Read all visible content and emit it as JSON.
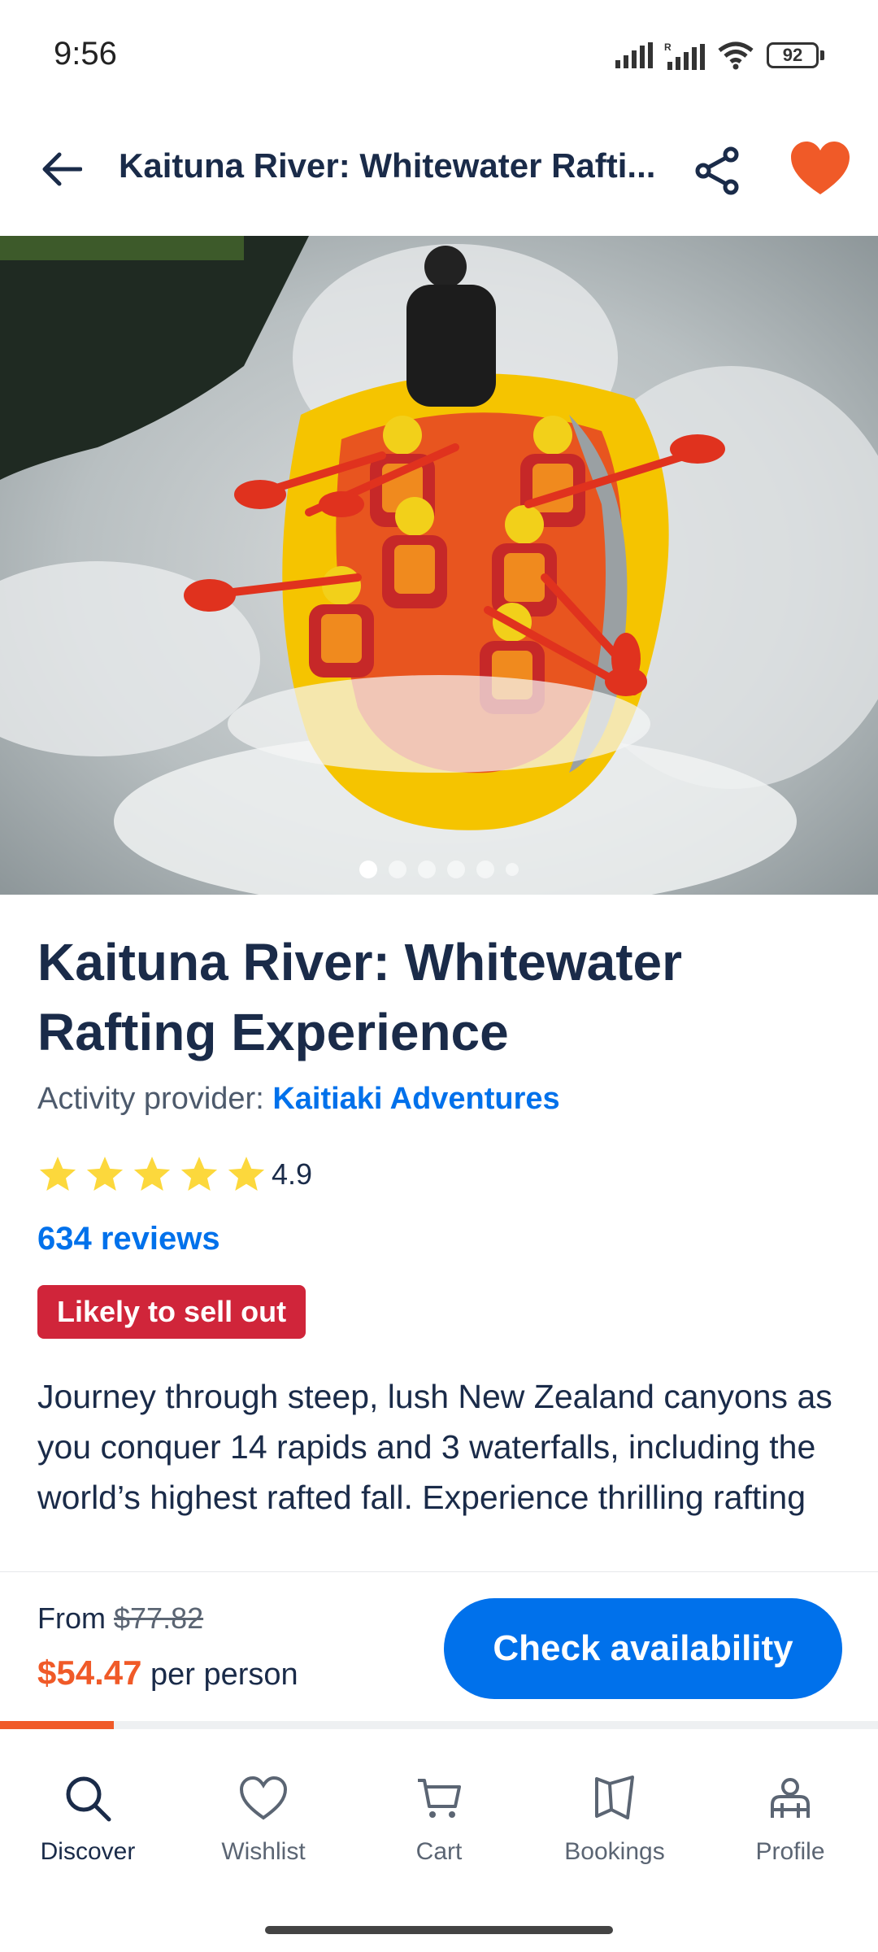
{
  "status_bar": {
    "time": "9:56",
    "battery": "92"
  },
  "header": {
    "title": "Kaituna River: Whitewater Rafti...",
    "back_icon": "arrow-left-icon",
    "share_icon": "share-icon",
    "favorite_icon": "heart-filled-icon"
  },
  "hero": {
    "slide_count": 6,
    "active_slide": 1
  },
  "activity": {
    "title": "Kaituna River: Whitewater Rafting Experience",
    "provider_label": "Activity provider: ",
    "provider_name": "Kaitiaki Adventures",
    "rating": "4.9",
    "stars": 5,
    "reviews": "634 reviews",
    "badge": "Likely to sell out",
    "description": "Journey through steep, lush New Zealand canyons as you conquer 14 rapids and 3 waterfalls, including the world’s highest rafted fall. Experience thrilling rafting infused with rich Māori culture."
  },
  "pricing": {
    "from_label": "From ",
    "original_price": "$77.82",
    "current_price": "$54.47",
    "unit": " per person",
    "cta": "Check availability"
  },
  "scroll_progress": 0.13,
  "nav": {
    "items": [
      {
        "label": "Discover",
        "icon": "search-icon",
        "active": true
      },
      {
        "label": "Wishlist",
        "icon": "heart-outline-icon",
        "active": false
      },
      {
        "label": "Cart",
        "icon": "cart-icon",
        "active": false
      },
      {
        "label": "Bookings",
        "icon": "bookings-icon",
        "active": false
      },
      {
        "label": "Profile",
        "icon": "profile-icon",
        "active": false
      }
    ]
  },
  "colors": {
    "brand_blue": "#0071eb",
    "accent_orange": "#f05a28",
    "badge_red": "#d0253a",
    "text_dark": "#1a2b49",
    "star_yellow": "#fcd83c"
  }
}
